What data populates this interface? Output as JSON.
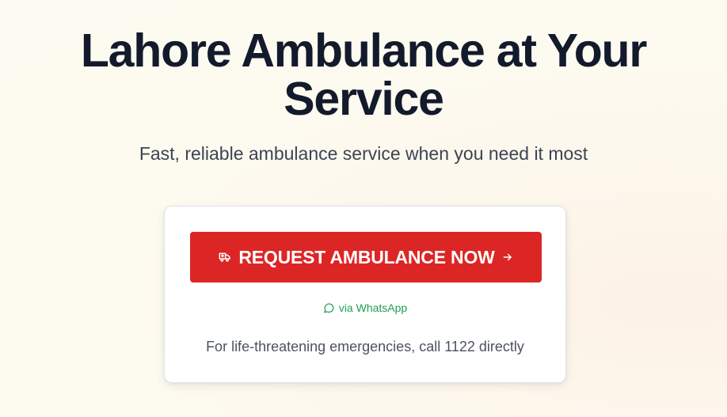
{
  "hero": {
    "title_line1": "Lahore Ambulance at Your",
    "title_line2": "Service",
    "subtitle": "Fast, reliable ambulance service when you need it most"
  },
  "cta": {
    "button_label": "REQUEST AMBULANCE NOW",
    "button_icon": "ambulance-truck-icon",
    "button_trailing_icon": "arrow-right-icon",
    "whatsapp_label": "via WhatsApp",
    "whatsapp_icon": "message-circle-icon",
    "emergency_note": "For life-threatening emergencies, call 1122 directly"
  },
  "colors": {
    "accent": "#dc2626",
    "whatsapp": "#1e9e4f",
    "title": "#131a2c",
    "background": "#fdfbf1"
  }
}
